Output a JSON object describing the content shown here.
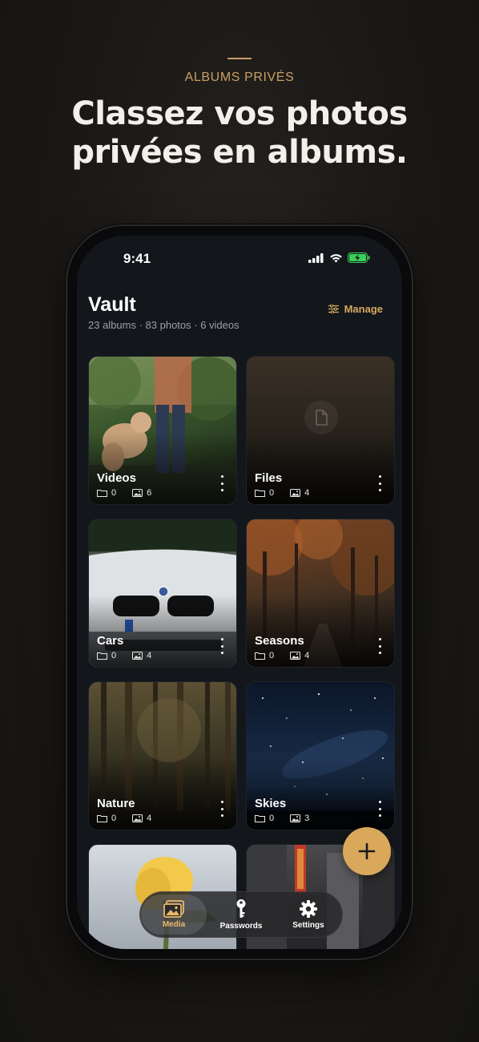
{
  "hero": {
    "kicker": "ALBUMS PRIVÉS",
    "title_line1": "Classez vos photos",
    "title_line2": "privées en albums."
  },
  "status": {
    "time": "9:41",
    "battery_color": "#3ecf5a"
  },
  "header": {
    "title": "Vault",
    "subtitle": "23 albums · 83 photos · 6 videos",
    "manage_label": "Manage"
  },
  "albums": [
    {
      "name": "Videos",
      "folders": "0",
      "items": "6",
      "theme": "dog-park"
    },
    {
      "name": "Files",
      "folders": "0",
      "items": "4",
      "theme": "file-placeholder"
    },
    {
      "name": "Cars",
      "folders": "0",
      "items": "4",
      "theme": "white-bmw"
    },
    {
      "name": "Seasons",
      "folders": "0",
      "items": "4",
      "theme": "autumn-forest"
    },
    {
      "name": "Nature",
      "folders": "0",
      "items": "4",
      "theme": "dark-forest"
    },
    {
      "name": "Skies",
      "folders": "0",
      "items": "3",
      "theme": "starry-sky"
    },
    {
      "name": "",
      "folders": "",
      "items": "",
      "theme": "yellow-rose"
    },
    {
      "name": "",
      "folders": "",
      "items": "",
      "theme": "city-street"
    }
  ],
  "tabbar": {
    "tabs": [
      {
        "label": "Media",
        "icon": "photos-icon",
        "active": true
      },
      {
        "label": "Passwords",
        "icon": "key-icon",
        "active": false
      },
      {
        "label": "Settings",
        "icon": "gear-icon",
        "active": false
      }
    ]
  },
  "colors": {
    "accent": "#d9a85b",
    "background": "#13161b"
  }
}
